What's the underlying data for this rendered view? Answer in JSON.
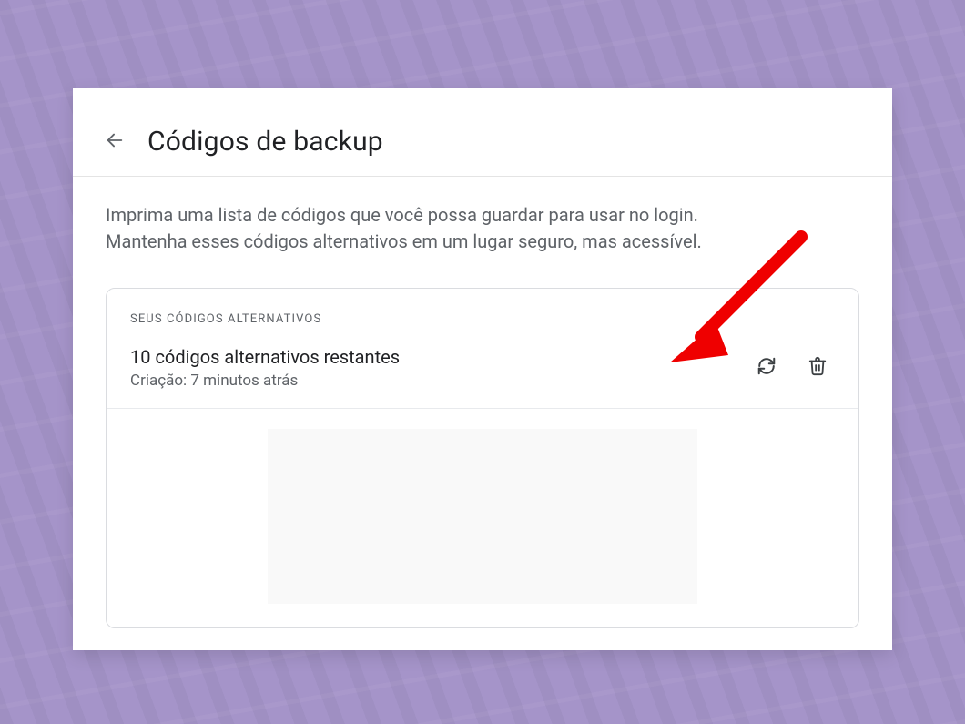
{
  "header": {
    "title": "Códigos de backup"
  },
  "description": {
    "line1": "Imprima uma lista de códigos que você possa guardar para usar no login.",
    "line2": "Mantenha esses códigos alternativos em um lugar seguro, mas acessível."
  },
  "card": {
    "section_label": "SEUS CÓDIGOS ALTERNATIVOS",
    "codes_remaining": "10 códigos alternativos restantes",
    "created_at": "Criação: 7 minutos atrás"
  },
  "icons": {
    "back": "arrow-left-icon",
    "refresh": "refresh-icon",
    "delete": "trash-icon"
  },
  "annotation": {
    "arrow_color": "#ef0000"
  }
}
